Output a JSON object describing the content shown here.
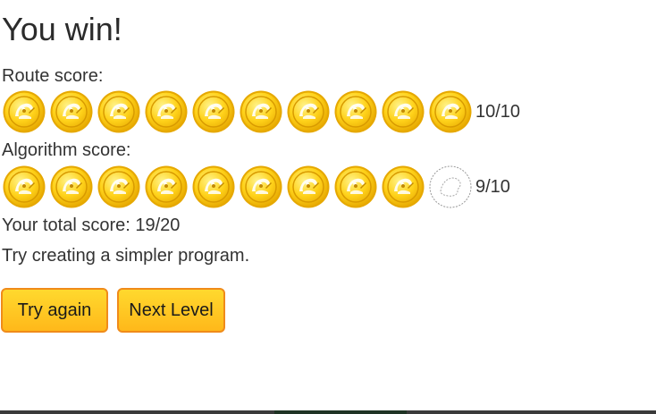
{
  "result": {
    "title": "You win!",
    "route_label": "Route score:",
    "route_score": {
      "earned": 10,
      "total": 10,
      "text": "10/10"
    },
    "algorithm_label": "Algorithm score:",
    "algorithm_score": {
      "earned": 9,
      "total": 10,
      "text": "9/10"
    },
    "total_text": "Your total score: 19/20",
    "hint": "Try creating a simpler program."
  },
  "buttons": {
    "try_again": "Try again",
    "next_level": "Next Level"
  },
  "icons": {
    "earned_coin": "gold-coin-icon",
    "missing_coin": "empty-coin-outline-icon"
  },
  "colors": {
    "coin_gold": "#ffd21a",
    "coin_edge": "#e6a800",
    "button_fill": "#ffc629",
    "button_border": "#f08b1a",
    "text": "#333333"
  }
}
